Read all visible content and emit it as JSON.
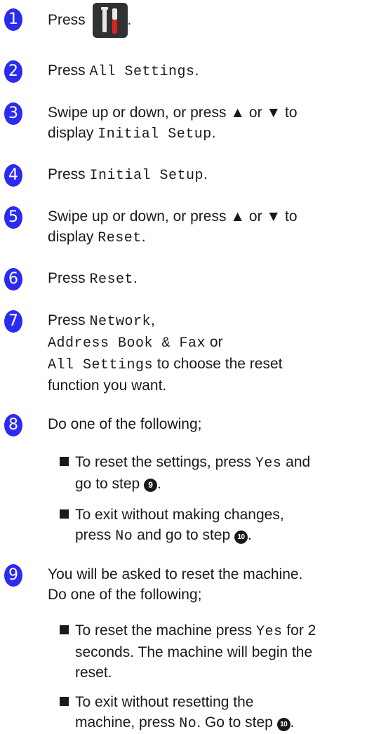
{
  "steps": [
    {
      "num": "1",
      "press": "Press",
      "after": "."
    },
    {
      "num": "2",
      "press": "Press",
      "mono": "All Settings",
      "after": "."
    },
    {
      "num": "3",
      "line1": "Swipe up or down, or press ▲ or ▼ to",
      "display": "display",
      "mono": "Initial Setup",
      "after": "."
    },
    {
      "num": "4",
      "press": "Press",
      "mono": "Initial Setup",
      "after": "."
    },
    {
      "num": "5",
      "line1": "Swipe up or down, or press ▲ or ▼ to",
      "display": "display",
      "mono": "Reset",
      "after": "."
    },
    {
      "num": "6",
      "press": "Press",
      "mono": "Reset",
      "after": "."
    },
    {
      "num": "7",
      "press": "Press",
      "mono1": "Network",
      "comma": ",",
      "mono2": "Address Book & Fax",
      "or": "or",
      "mono3": "All Settings",
      "rest1": "to choose the reset",
      "rest2": "function you want."
    },
    {
      "num": "8",
      "text": "Do one of the following;",
      "b1": {
        "pre": "To reset the settings, press",
        "mono": "Yes",
        "mid": "and",
        "post": "go to step",
        "ref": "9",
        "end": "."
      },
      "b2": {
        "pre": "To exit without making changes,",
        "post1": "press",
        "mono": "No",
        "mid": "and go to step",
        "ref": "10",
        "end": "."
      }
    },
    {
      "num": "9",
      "line1": "You will be asked to reset the machine.",
      "line2": "Do one of the following;",
      "b1": {
        "pre": "To reset the machine press",
        "mono": "Yes",
        "mid": "for 2",
        "line2": "seconds. The machine will begin the",
        "line3": "reset."
      },
      "b2": {
        "pre": "To exit without resetting the",
        "post1": "machine, press",
        "mono": "No",
        "mid": ". Go to step",
        "ref": "10",
        "end": "."
      }
    }
  ],
  "icons": {
    "settings": "tools-icon (screwdriver and wrench)"
  },
  "colors": {
    "step_number": "#2b2bf0",
    "settings_icon_bg": "#2f3133"
  }
}
